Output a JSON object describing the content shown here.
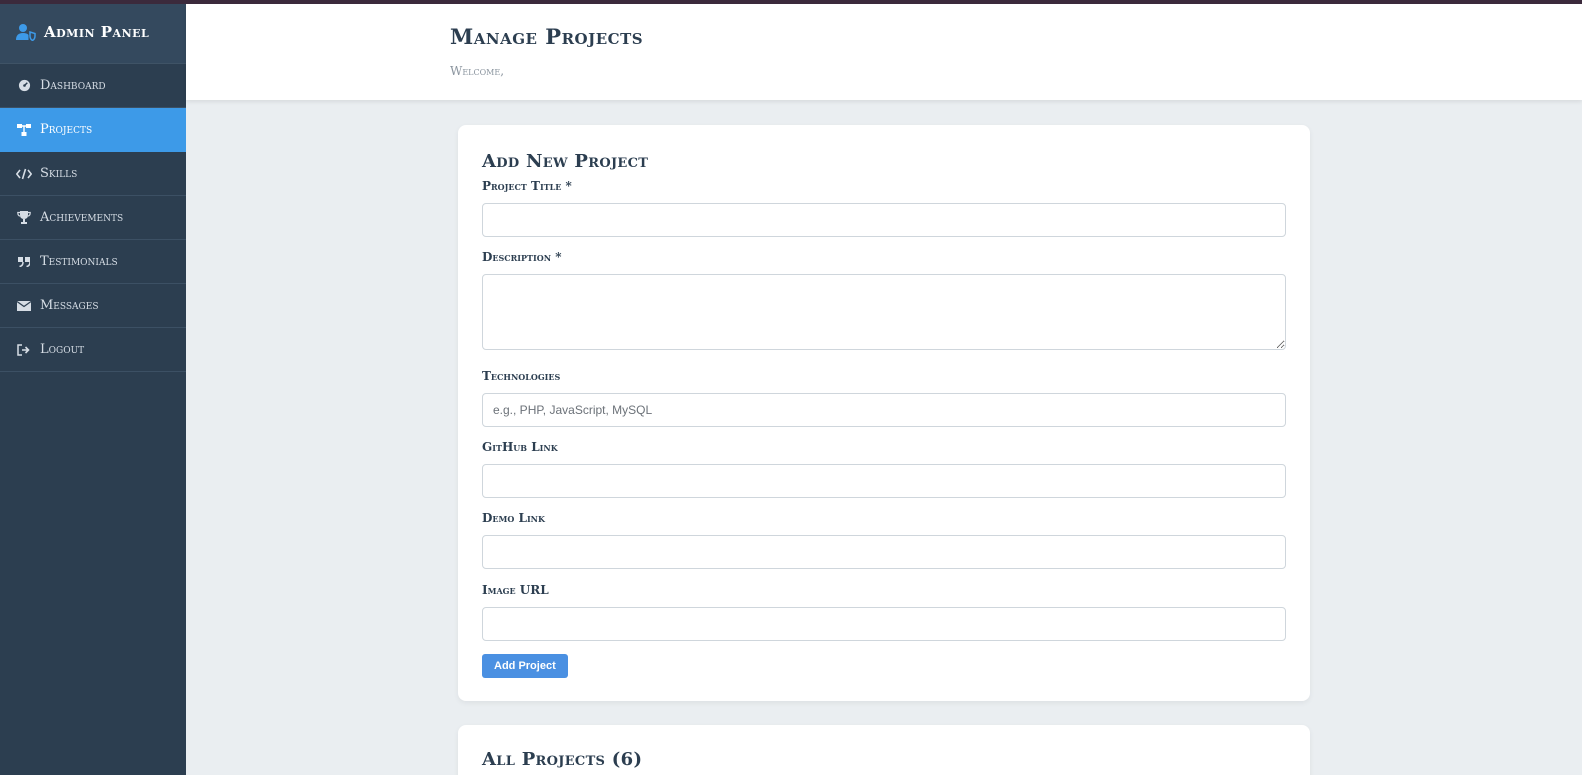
{
  "sidebar": {
    "brand": "Admin Panel",
    "items": [
      {
        "label": "Dashboard",
        "icon": "dashboard-icon",
        "active": false
      },
      {
        "label": "Projects",
        "icon": "sitemap-icon",
        "active": true
      },
      {
        "label": "Skills",
        "icon": "code-icon",
        "active": false
      },
      {
        "label": "Achievements",
        "icon": "trophy-icon",
        "active": false
      },
      {
        "label": "Testimonials",
        "icon": "quote-icon",
        "active": false
      },
      {
        "label": "Messages",
        "icon": "envelope-icon",
        "active": false
      },
      {
        "label": "Logout",
        "icon": "sign-out-icon",
        "active": false
      }
    ]
  },
  "header": {
    "title": "Manage Projects",
    "welcome": "Welcome,"
  },
  "form": {
    "title": "Add New Project",
    "fields": {
      "title": {
        "label": "Project Title *",
        "value": "",
        "placeholder": ""
      },
      "description": {
        "label": "Description *",
        "value": "",
        "placeholder": ""
      },
      "technologies": {
        "label": "Technologies",
        "value": "",
        "placeholder": "e.g., PHP, JavaScript, MySQL"
      },
      "github": {
        "label": "GitHub Link",
        "value": "",
        "placeholder": ""
      },
      "demo": {
        "label": "Demo Link",
        "value": "",
        "placeholder": ""
      },
      "image": {
        "label": "Image URL",
        "value": "",
        "placeholder": ""
      }
    },
    "submit_label": "Add Project"
  },
  "list": {
    "title": "All Projects (6)"
  },
  "colors": {
    "sidebar_bg": "#2c3e50",
    "active_item": "#3d9ae8",
    "button": "#4a90e2",
    "page_bg": "#eaeef1"
  }
}
